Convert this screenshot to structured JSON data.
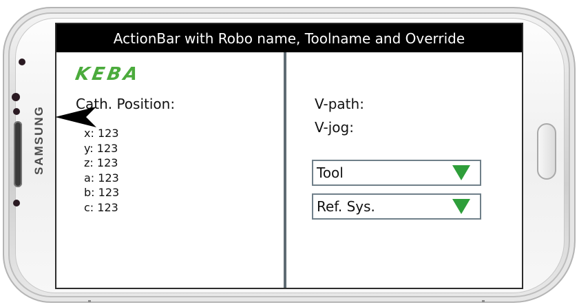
{
  "device": {
    "brand": "SAMSUNG"
  },
  "action_bar": {
    "title": "ActionBar with Robo name, Toolname and Override"
  },
  "logo": {
    "text": "KEBA",
    "color": "#4bab3c"
  },
  "left_panel": {
    "title": "Cath. Position:",
    "coords": [
      {
        "label": "x:",
        "value": "123"
      },
      {
        "label": "y:",
        "value": "123"
      },
      {
        "label": "z:",
        "value": "123"
      },
      {
        "label": "a:",
        "value": "123"
      },
      {
        "label": "b:",
        "value": "123"
      },
      {
        "label": "c:",
        "value": "123"
      }
    ]
  },
  "right_panel": {
    "v_path_label": "V-path:",
    "v_jog_label": "V-jog:",
    "tool_dropdown": {
      "value": "Tool",
      "icon": "triangle-down-icon",
      "color": "#2e9e3a"
    },
    "ref_sys_dropdown": {
      "value": "Ref. Sys.",
      "icon": "triangle-down-icon",
      "color": "#2e9e3a"
    }
  }
}
